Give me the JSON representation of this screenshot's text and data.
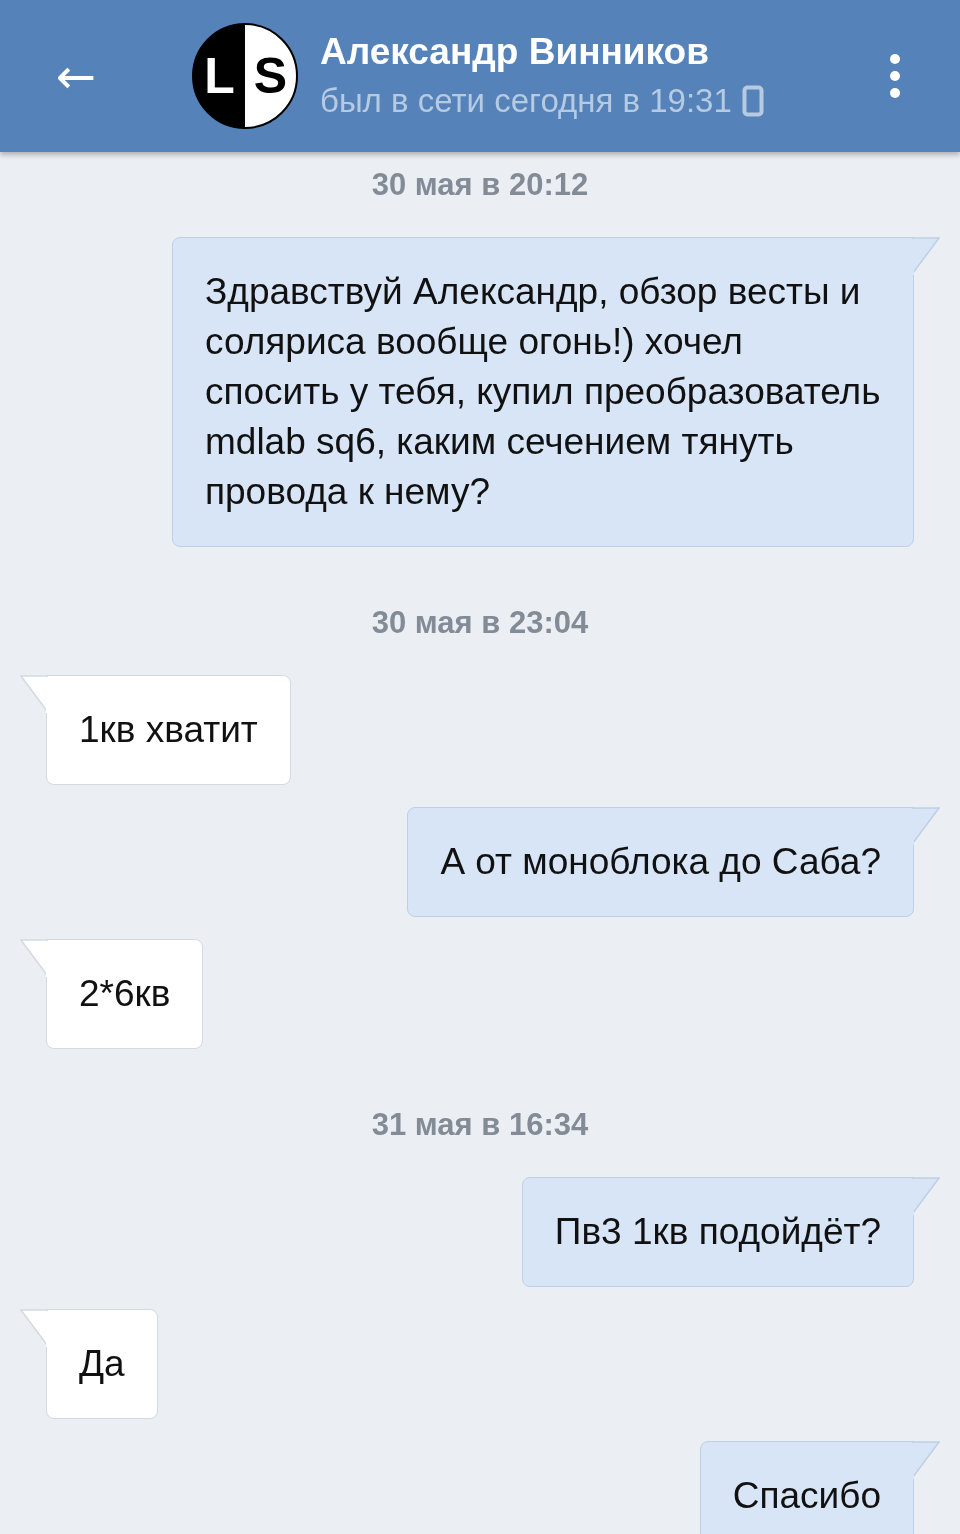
{
  "header": {
    "back": "←",
    "avatar": {
      "left": "L",
      "right": "S"
    },
    "name": "Александр Винников",
    "status": "был в сети сегодня в 19:31"
  },
  "messages": [
    {
      "kind": "date",
      "text": "30 мая в 20:12"
    },
    {
      "kind": "out",
      "text": "Здравствуй Александр, обзор весты и соляриса вообще огонь!) хочел спосить у тебя, купил преобразователь mdlab sq6, каким сечением тянуть провода к нему?"
    },
    {
      "kind": "date",
      "text": "30 мая в 23:04"
    },
    {
      "kind": "in",
      "text": "1кв хватит"
    },
    {
      "kind": "out",
      "text": "А от моноблока до Саба?"
    },
    {
      "kind": "in",
      "text": "2*6кв"
    },
    {
      "kind": "date",
      "text": "31 мая в 16:34"
    },
    {
      "kind": "out",
      "text": "Пв3 1кв подойдёт?"
    },
    {
      "kind": "in",
      "text": "Да"
    },
    {
      "kind": "out",
      "text": "Спасибо"
    }
  ]
}
